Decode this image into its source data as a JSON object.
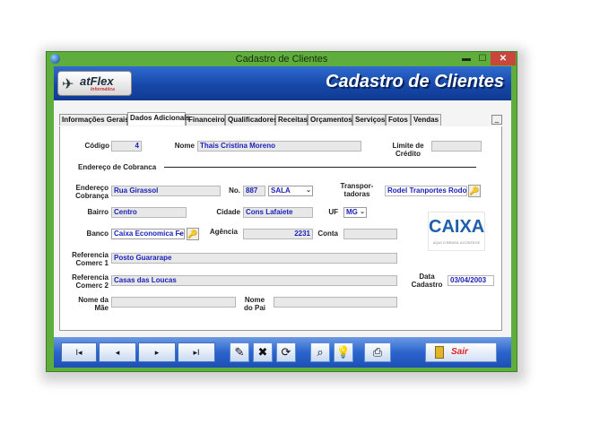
{
  "window": {
    "title": "Cadastro de Clientes"
  },
  "banner": {
    "logo_text": "atFlex",
    "logo_sub": "Informática",
    "title": "Cadastro de Clientes"
  },
  "tabs": [
    {
      "label": "Informações Gerais"
    },
    {
      "label": "Dados Adicionais"
    },
    {
      "label": "Financeiro"
    },
    {
      "label": "Qualificadores"
    },
    {
      "label": "Receitas"
    },
    {
      "label": "Orçamentos"
    },
    {
      "label": "Serviços"
    },
    {
      "label": "Fotos"
    },
    {
      "label": "Vendas"
    }
  ],
  "tab_close_label": "_",
  "form": {
    "codigo_label": "Código",
    "codigo": "4",
    "nome_label": "Nome",
    "nome": "Thais Cristina Moreno",
    "limite_label_1": "Limite de",
    "limite_label_2": "Crédito",
    "limite": "",
    "endereco_section": "Endereço de Cobranca",
    "endereco_label_1": "Endereço",
    "endereco_label_2": "Cobrança",
    "endereco": "Rua Girassol",
    "no_label": "No.",
    "no": "887",
    "complemento": "SALA",
    "transp_label_1": "Transpor-",
    "transp_label_2": "tadoras",
    "transportadora": "Rodel Tranportes Rodoviá",
    "bairro_label": "Bairro",
    "bairro": "Centro",
    "cidade_label": "Cidade",
    "cidade": "Cons Lafaiete",
    "uf_label": "UF",
    "uf": "MG",
    "banco_label": "Banco",
    "banco": "Caixa Economica Fed",
    "agencia_label": "Agência",
    "agencia": "2231",
    "conta_label": "Conta",
    "conta": "",
    "ref1_label_1": "Referencia",
    "ref1_label_2": "Comerc 1",
    "ref1": "Posto Guararape",
    "ref2_label_1": "Referencia",
    "ref2_label_2": "Comerc 2",
    "ref2": "Casas das Loucas",
    "data_label_1": "Data",
    "data_label_2": "Cadastro",
    "data_cadastro": "03/04/2003",
    "mae_label_1": "Nome da",
    "mae_label_2": "Mãe",
    "mae": "",
    "pai_label_1": "Nome",
    "pai_label_2": "do Pai",
    "pai": ""
  },
  "bank_logo": {
    "name": "CAIXA",
    "tagline": "AQUI O BRASIL ACONTECE"
  },
  "toolbar": {
    "first": "I◂",
    "prev": "◂",
    "next": "▸",
    "last": "▸I",
    "sair": "Sair"
  },
  "colors": {
    "frame": "#5fae3d",
    "banner": "#1748a8",
    "field_text": "#1a22b8",
    "sair": "#dd2222"
  }
}
